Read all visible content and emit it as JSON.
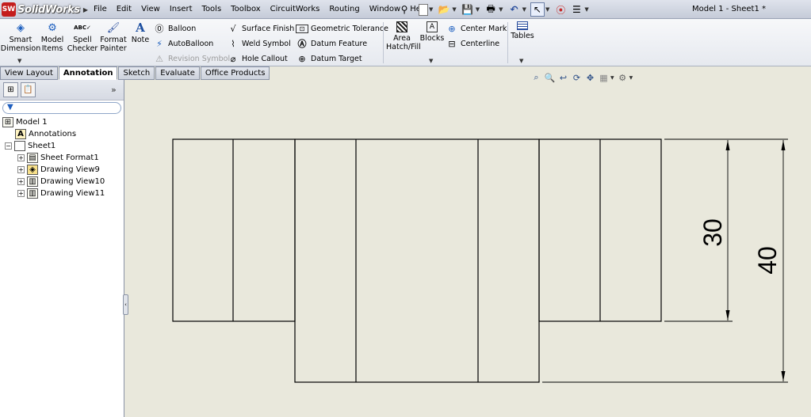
{
  "app": {
    "logo_text": "SolidWorks",
    "document_title": "Model 1 - Sheet1 *"
  },
  "menu": [
    "File",
    "Edit",
    "View",
    "Insert",
    "Tools",
    "Toolbox",
    "CircuitWorks",
    "Routing",
    "Window",
    "Help"
  ],
  "ribbon": {
    "smart_dimension": "Smart Dimension",
    "model_items": "Model Items",
    "spell_checker": "Spell Checker",
    "format_painter": "Format Painter",
    "note": "Note",
    "balloon": "Balloon",
    "autoballoon": "AutoBalloon",
    "revision_symbol": "Revision Symbol",
    "surface_finish": "Surface Finish",
    "weld_symbol": "Weld Symbol",
    "hole_callout": "Hole Callout",
    "geometric_tolerance": "Geometric Tolerance",
    "datum_feature": "Datum Feature",
    "datum_target": "Datum Target",
    "area_hatch_fill": "Area Hatch/Fill",
    "blocks": "Blocks",
    "center_mark": "Center Mark",
    "centerline": "Centerline",
    "tables": "Tables"
  },
  "tabs": [
    {
      "label": "View Layout",
      "active": false
    },
    {
      "label": "Annotation",
      "active": true
    },
    {
      "label": "Sketch",
      "active": false
    },
    {
      "label": "Evaluate",
      "active": false
    },
    {
      "label": "Office Products",
      "active": false
    }
  ],
  "tree": {
    "root": "Model 1",
    "annotations": "Annotations",
    "sheet": "Sheet1",
    "children": [
      "Sheet Format1",
      "Drawing View9",
      "Drawing View10",
      "Drawing View11"
    ]
  },
  "drawing": {
    "dimension_inner": "30",
    "dimension_outer": "40"
  },
  "colors": {
    "graphics_bg": "#e9e8dc",
    "line": "#000000"
  }
}
